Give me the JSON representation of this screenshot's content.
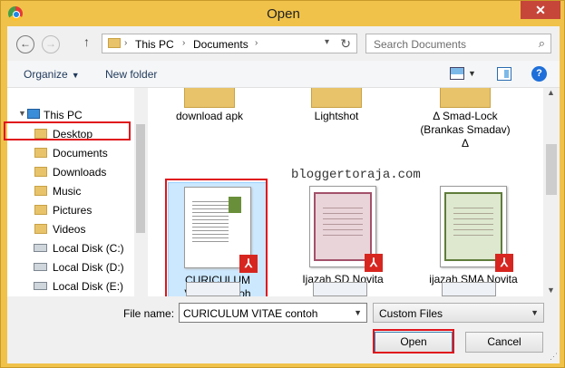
{
  "window": {
    "title": "Open",
    "close_glyph": "✕"
  },
  "nav_buttons": {
    "back": "←",
    "forward": "→",
    "up": "↑"
  },
  "address": {
    "crumbs": [
      "This PC",
      "Documents"
    ],
    "separator": "›"
  },
  "search": {
    "placeholder": "Search Documents"
  },
  "toolbar": {
    "organize": "Organize",
    "new_folder": "New folder",
    "help": "?"
  },
  "navpane": {
    "items": [
      {
        "label": "This PC",
        "icon": "pc-icon"
      },
      {
        "label": "Desktop",
        "icon": "folder-icon"
      },
      {
        "label": "Documents",
        "icon": "folder-icon",
        "selected": true
      },
      {
        "label": "Downloads",
        "icon": "folder-icon"
      },
      {
        "label": "Music",
        "icon": "folder-icon"
      },
      {
        "label": "Pictures",
        "icon": "folder-icon"
      },
      {
        "label": "Videos",
        "icon": "folder-icon"
      },
      {
        "label": "Local Disk (C:)",
        "icon": "disk-icon"
      },
      {
        "label": "Local Disk (D:)",
        "icon": "disk-icon"
      },
      {
        "label": "Local Disk (E:)",
        "icon": "disk-icon"
      }
    ]
  },
  "folders": [
    {
      "name": "download apk"
    },
    {
      "name": "Lightshot"
    },
    {
      "name": "Δ Smad-Lock (Brankas Smadav) Δ"
    }
  ],
  "files": [
    {
      "name": "CURICULUM VITAE contoh",
      "type": "pdf",
      "selected": true
    },
    {
      "name": "Ijazah SD Novita",
      "type": "pdf"
    },
    {
      "name": "ijazah SMA Novita",
      "type": "pdf"
    }
  ],
  "watermark": "bloggertoraja.com",
  "bottom": {
    "file_name_label": "File name:",
    "file_name_value": "CURICULUM VITAE contoh",
    "file_type": "Custom Files",
    "open_label": "Open",
    "cancel_label": "Cancel"
  },
  "colors": {
    "title_bar": "#f0c24a",
    "highlight_outline": "#e0141c",
    "selection": "#cce8ff"
  }
}
